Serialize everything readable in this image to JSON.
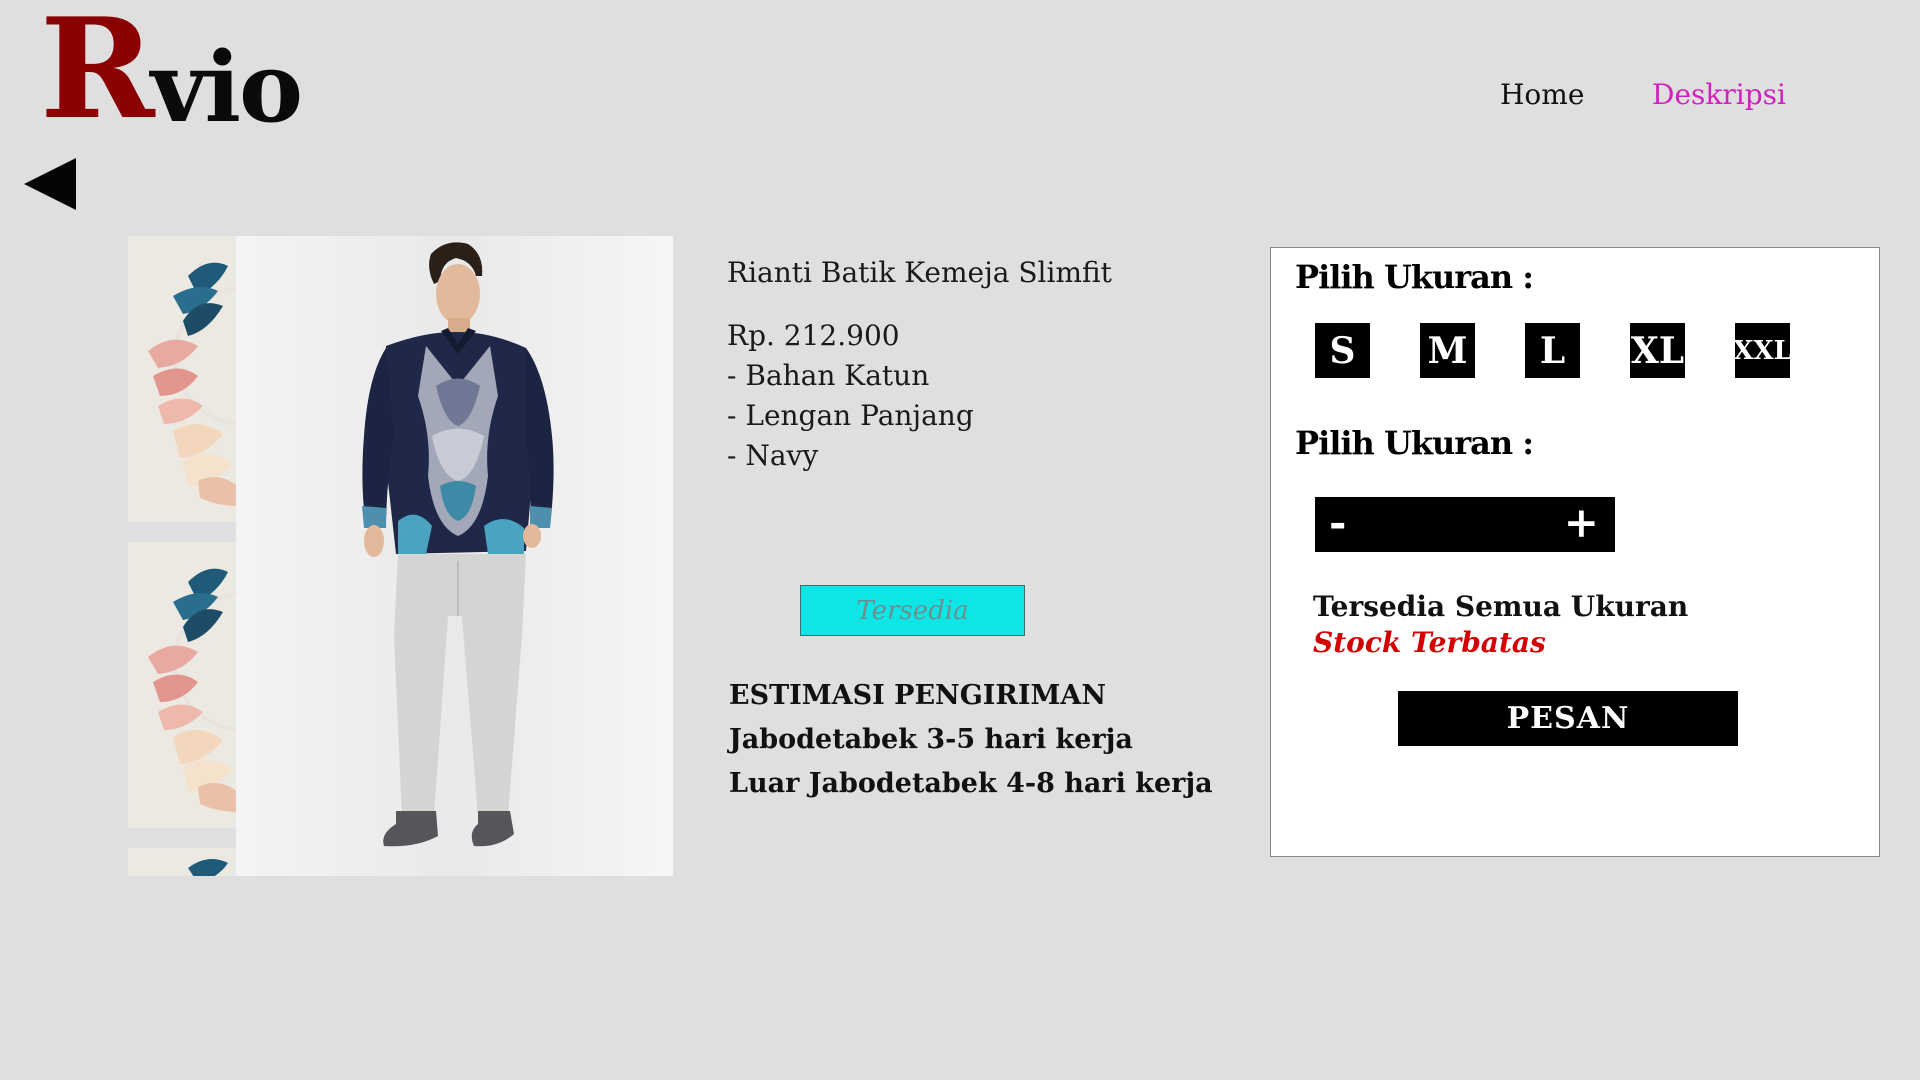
{
  "brand": {
    "logo_big": "R",
    "logo_rest": "vio"
  },
  "nav": {
    "home": "Home",
    "description": "Deskripsi",
    "active_color": "#d21fbf"
  },
  "product": {
    "name": "Rianti Batik Kemeja Slimfit",
    "price": "Rp. 212.900",
    "details": [
      "- Bahan Katun",
      "- Lengan Panjang",
      "- Navy"
    ],
    "availability_badge": "Tersedia"
  },
  "shipping": {
    "title": "ESTIMASI PENGIRIMAN",
    "lines": [
      "Jabodetabek 3-5 hari kerja",
      "Luar Jabodetabek 4-8 hari kerja"
    ]
  },
  "order_panel": {
    "size_title": "Pilih Ukuran :",
    "qty_title": "Pilih Ukuran :",
    "sizes": [
      "S",
      "M",
      "L",
      "XL",
      "XXL"
    ],
    "minus": "-",
    "plus": "+",
    "availability": "Tersedia Semua Ukuran",
    "stock": "Stock Terbatas",
    "order_button": "PESAN"
  },
  "icons": {
    "back": "back-arrow-icon"
  },
  "colors": {
    "logo_accent": "#8b0000",
    "badge": "#0ce6e6",
    "stock": "#d40000",
    "background": "#e0dfe0"
  }
}
